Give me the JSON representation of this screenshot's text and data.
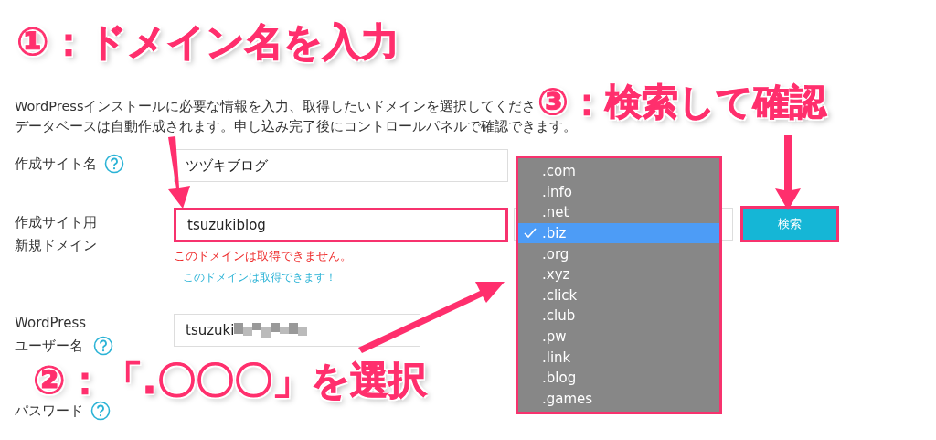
{
  "annotations": [
    {
      "kind": "enter",
      "number": "①",
      "text": "：ドメイン名を入力"
    },
    {
      "kind": "select",
      "number": "②",
      "text": "：「.〇〇〇」を選択"
    },
    {
      "kind": "search",
      "number": "③",
      "text": "：検索して確認"
    }
  ],
  "intro": [
    "WordPressインストールに必要な情報を入力、取得したいドメインを選択してくださ",
    "データベースは自動作成されます。申し込み完了後にコントロールパネルで確認できます。"
  ],
  "rows": [
    {
      "kind": "site",
      "label": [
        "作成サイト名"
      ],
      "help": true,
      "value": "ツヅキブログ"
    },
    {
      "kind": "domain",
      "label": [
        "作成サイト用",
        "新規ドメイン"
      ],
      "value": "tsuzukiblog",
      "error": "このドメインは取得できません。",
      "ok": "このドメインは取得できます！",
      "button": "検索"
    },
    {
      "kind": "user",
      "label": [
        "WordPress",
        "ユーザー名"
      ],
      "help": true,
      "value": "tsuzuki"
    },
    {
      "kind": "password",
      "label": [
        "パスワード"
      ],
      "help": true
    }
  ],
  "dropdown": [
    {
      "label": ".com",
      "selected": false
    },
    {
      "label": ".info",
      "selected": false
    },
    {
      "label": ".net",
      "selected": false
    },
    {
      "label": ".biz",
      "selected": true
    },
    {
      "label": ".org",
      "selected": false
    },
    {
      "label": ".xyz",
      "selected": false
    },
    {
      "label": ".click",
      "selected": false
    },
    {
      "label": ".club",
      "selected": false
    },
    {
      "label": ".pw",
      "selected": false
    },
    {
      "label": ".link",
      "selected": false
    },
    {
      "label": ".blog",
      "selected": false
    },
    {
      "label": ".games",
      "selected": false
    }
  ]
}
